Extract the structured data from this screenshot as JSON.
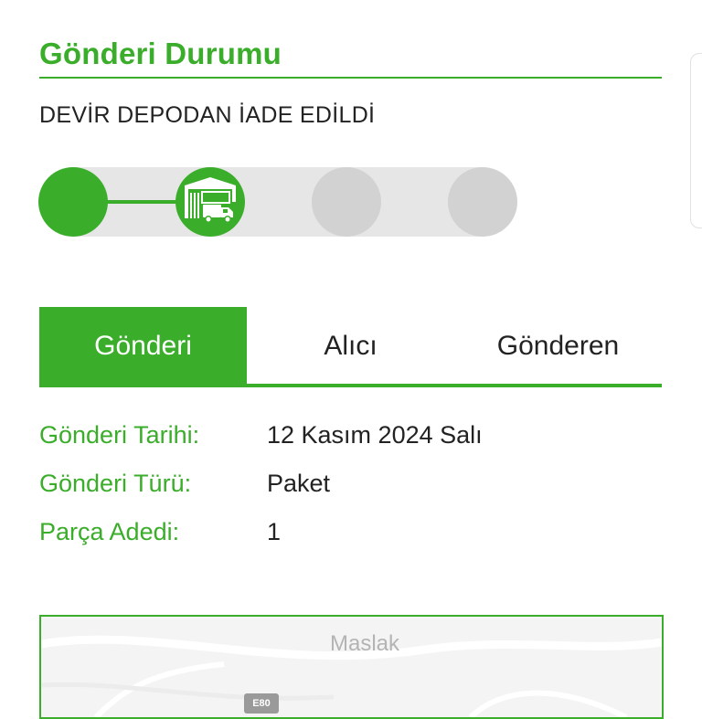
{
  "header": {
    "title": "Gönderi Durumu",
    "status": "DEVİR DEPODAN İADE EDİLDİ"
  },
  "tracker": {
    "steps_total": 4,
    "current_step": 2,
    "current_step_icon": "warehouse-truck-icon"
  },
  "tabs": [
    {
      "label": "Gönderi",
      "active": true
    },
    {
      "label": "Alıcı",
      "active": false
    },
    {
      "label": "Gönderen",
      "active": false
    }
  ],
  "details": [
    {
      "label": "Gönderi Tarihi:",
      "value": "12 Kasım 2024 Salı"
    },
    {
      "label": "Gönderi Türü:",
      "value": "Paket"
    },
    {
      "label": "Parça Adedi:",
      "value": "1"
    }
  ],
  "map": {
    "place_label": "Maslak",
    "road_sign": "E80"
  },
  "colors": {
    "accent": "#3aad2a",
    "inactive_step": "#d2d2d2",
    "track": "#e6e6e6",
    "text": "#222222"
  }
}
